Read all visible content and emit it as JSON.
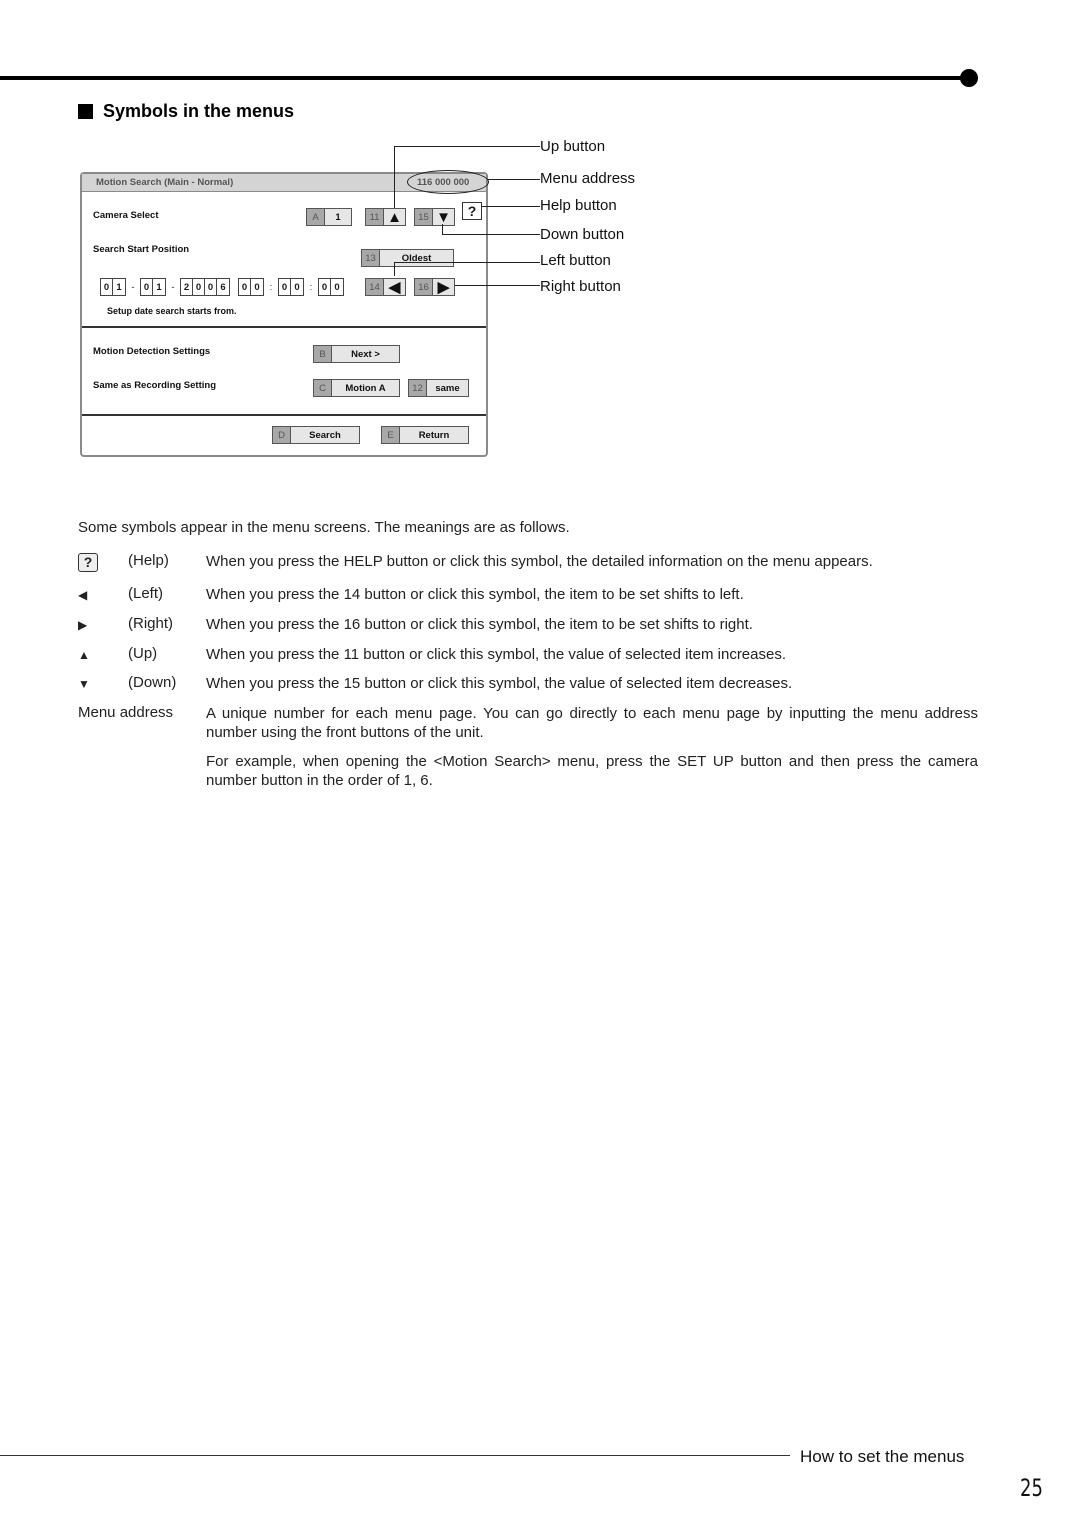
{
  "section": {
    "title": "Symbols in the menus"
  },
  "menu": {
    "title": "Motion Search (Main - Normal)",
    "address": "116 000 000",
    "camera_select": {
      "label": "Camera Select",
      "key": "A",
      "value": "1"
    },
    "up": {
      "key": "11",
      "glyph": "▲"
    },
    "down": {
      "key": "15",
      "glyph": "▼"
    },
    "help_glyph": "?",
    "search_start": {
      "label": "Search Start Position",
      "key": "13",
      "value": "Oldest"
    },
    "date": {
      "day": [
        "0",
        "1"
      ],
      "month": [
        "0",
        "1"
      ],
      "year": [
        "2",
        "0",
        "0",
        "6"
      ],
      "hour": [
        "0",
        "0"
      ],
      "minute": [
        "0",
        "0"
      ],
      "second": [
        "0",
        "0"
      ],
      "date_sep": "-",
      "time_sep": ":"
    },
    "left": {
      "key": "14",
      "glyph": "◀"
    },
    "right": {
      "key": "16",
      "glyph": "▶"
    },
    "hint": "Setup date search starts from.",
    "motion_detection": {
      "label": "Motion Detection Settings",
      "key": "B",
      "value": "Next >"
    },
    "same_recording": {
      "label": "Same as Recording Setting",
      "key": "C",
      "value": "Motion A",
      "key2": "12",
      "value2": "same"
    },
    "search_btn": {
      "key": "D",
      "value": "Search"
    },
    "return_btn": {
      "key": "E",
      "value": "Return"
    }
  },
  "callouts": [
    "Up button",
    "Menu address",
    "Help button",
    "Down button",
    "Left button",
    "Right button"
  ],
  "body": {
    "intro": "Some symbols appear in the menu screens. The meanings are as follows.",
    "symbols": [
      {
        "icon": "?",
        "name": "(Help)",
        "desc": "When you press the HELP button or click this symbol, the detailed information on the menu appears."
      },
      {
        "icon": "◀",
        "name": "(Left)",
        "desc": "When you press the 14 button or click this symbol, the item to be set shifts to left."
      },
      {
        "icon": "▶",
        "name": "(Right)",
        "desc": "When you press the 16 button or click this symbol, the item to be set shifts to right."
      },
      {
        "icon": "▲",
        "name": "(Up)",
        "desc": "When you press the 11 button or click this symbol, the value of selected item increases."
      },
      {
        "icon": "▼",
        "name": "(Down)",
        "desc": "When you press the 15 button or click this symbol, the value of selected item decreases."
      }
    ],
    "menu_address": {
      "name": "Menu address",
      "desc1": "A unique number for each menu page. You can go directly to each menu page by inputting the menu address number using the front buttons of the unit.",
      "desc2": "For example, when opening the <Motion Search> menu, press the SET UP button and then press the camera number button in the order of 1, 6."
    }
  },
  "footer": {
    "title": "How to set the menus",
    "page": "25"
  }
}
